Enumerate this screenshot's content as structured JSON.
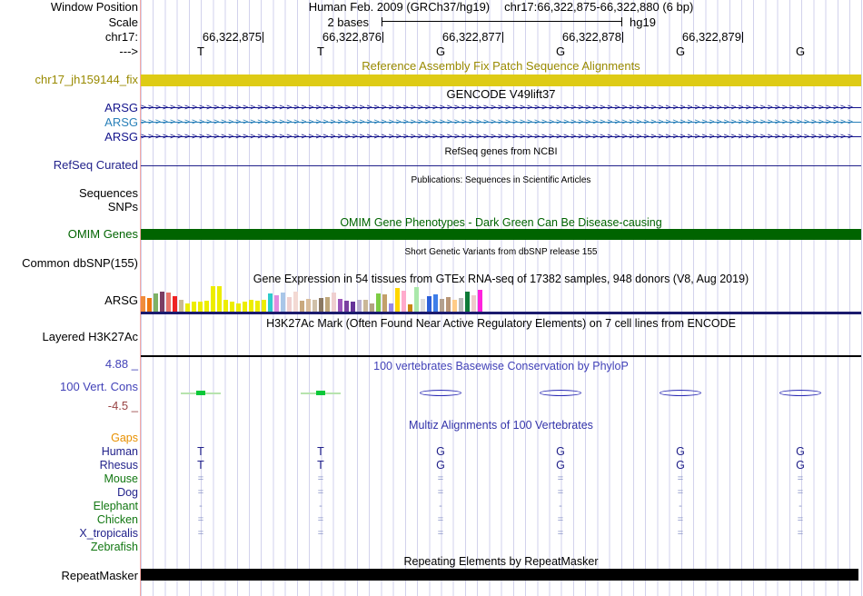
{
  "header": {
    "genome": "Human Feb. 2009 (GRCh37/hg19)",
    "position": "chr17:66,322,875-66,322,880 (6 bp)",
    "scale_value": "2 bases",
    "assembly": "hg19"
  },
  "left_labels": {
    "window_position": "Window Position",
    "scale": "Scale",
    "chrom": "chr17:",
    "direction": "--->",
    "fix_patch": "chr17_jh159144_fix",
    "refseq_curated": "RefSeq Curated",
    "sequences": "Sequences",
    "snps": "SNPs",
    "omim_genes": "OMIM Genes",
    "common_dbsnp": "Common dbSNP(155)",
    "gtex_gene": "ARSG",
    "layered_h3k27ac": "Layered H3K27Ac",
    "cons_upper_limit": "4.88 _",
    "cons_track": "100 Vert. Cons",
    "cons_lower_limit": "-4.5 _",
    "repeatmasker": "RepeatMasker"
  },
  "ruler": {
    "positions": [
      "66,322,875",
      "66,322,876",
      "66,322,877",
      "66,322,878",
      "66,322,879"
    ],
    "bases": [
      "T",
      "T",
      "G",
      "G",
      "G",
      "G"
    ]
  },
  "track_titles": {
    "fix_patch": "Reference Assembly Fix Patch Sequence Alignments",
    "gencode": "GENCODE V49lift37",
    "refseq": "RefSeq genes from NCBI",
    "publications": "Publications: Sequences in Scientific Articles",
    "omim": "OMIM Gene Phenotypes - Dark Green Can Be Disease-causing",
    "dbsnp": "Short Genetic Variants from dbSNP release 155",
    "gtex": "Gene Expression in 54 tissues from GTEx RNA-seq of 17382 samples, 948 donors (V8, Aug 2019)",
    "h3k27ac": "H3K27Ac Mark (Often Found Near Active Regulatory Elements) on 7 cell lines from ENCODE",
    "phylop": "100 vertebrates Basewise Conservation by PhyloP",
    "multiz": "Multiz Alignments of 100 Vertebrates",
    "repeatmasker": "Repeating Elements by RepeatMasker"
  },
  "gencode": {
    "transcripts": [
      {
        "label": "ARSG",
        "color": "#14148C"
      },
      {
        "label": "ARSG",
        "color": "#2980B9"
      },
      {
        "label": "ARSG",
        "color": "#14148C"
      }
    ]
  },
  "colors": {
    "fix_patch_bar": "#DECB15",
    "omim_bar": "#006400",
    "repeat_bar": "#000000",
    "gtex_baseline": "#1B1B6E",
    "refseq_line": "#22228B",
    "olive_text": "#998A00",
    "phylop_text": "#4242B8",
    "multiz_text": "#3333AA",
    "navy": "#22228B",
    "neg_limit_text": "#994444"
  },
  "chart_data": {
    "type": "bar",
    "title": "Gene Expression in 54 tissues from GTEx RNA-seq of 17382 samples, 948 donors (V8, Aug 2019)",
    "gene": "ARSG",
    "note": "values are relative expression bar heights in px (max 30)",
    "bars": [
      {
        "color": "#F08C3C",
        "value": 17
      },
      {
        "color": "#EE7711",
        "value": 15
      },
      {
        "color": "#7EB266",
        "value": 20
      },
      {
        "color": "#7A3D63",
        "value": 22
      },
      {
        "color": "#E8756A",
        "value": 21
      },
      {
        "color": "#EE2222",
        "value": 17
      },
      {
        "color": "#C9BA93",
        "value": 13
      },
      {
        "color": "#EDED00",
        "value": 9
      },
      {
        "color": "#EDED00",
        "value": 11
      },
      {
        "color": "#EDED00",
        "value": 11
      },
      {
        "color": "#EDED00",
        "value": 12
      },
      {
        "color": "#EDED00",
        "value": 28
      },
      {
        "color": "#EDED00",
        "value": 28
      },
      {
        "color": "#EDED00",
        "value": 13
      },
      {
        "color": "#EDED00",
        "value": 11
      },
      {
        "color": "#EDED00",
        "value": 9
      },
      {
        "color": "#EDED00",
        "value": 11
      },
      {
        "color": "#EDED00",
        "value": 13
      },
      {
        "color": "#EDED00",
        "value": 12
      },
      {
        "color": "#EDED00",
        "value": 13
      },
      {
        "color": "#2ECCCC",
        "value": 20
      },
      {
        "color": "#E08CE0",
        "value": 18
      },
      {
        "color": "#A9C6E8",
        "value": 21
      },
      {
        "color": "#EFCFCF",
        "value": 16
      },
      {
        "color": "#F3D9D3",
        "value": 22
      },
      {
        "color": "#C9A97E",
        "value": 12
      },
      {
        "color": "#D9BD9C",
        "value": 14
      },
      {
        "color": "#CFC0A8",
        "value": 13
      },
      {
        "color": "#8A7862",
        "value": 15
      },
      {
        "color": "#BFA77C",
        "value": 16
      },
      {
        "color": "#EFCFCF",
        "value": 21
      },
      {
        "color": "#9C55BB",
        "value": 14
      },
      {
        "color": "#7A3FA0",
        "value": 12
      },
      {
        "color": "#663399",
        "value": 11
      },
      {
        "color": "#B9AFCF",
        "value": 13
      },
      {
        "color": "#C9B797",
        "value": 13
      },
      {
        "color": "#B3A383",
        "value": 9
      },
      {
        "color": "#7ECC44",
        "value": 20
      },
      {
        "color": "#C3A06A",
        "value": 19
      },
      {
        "color": "#9688E8",
        "value": 9
      },
      {
        "color": "#FFD700",
        "value": 26
      },
      {
        "color": "#FFAACC",
        "value": 23
      },
      {
        "color": "#C98711",
        "value": 8
      },
      {
        "color": "#AAE8AA",
        "value": 27
      },
      {
        "color": "#DDDDDD",
        "value": 14
      },
      {
        "color": "#2B5FD9",
        "value": 17
      },
      {
        "color": "#3E7EE8",
        "value": 19
      },
      {
        "color": "#B3A08E",
        "value": 14
      },
      {
        "color": "#B99677",
        "value": 16
      },
      {
        "color": "#FFCC88",
        "value": 13
      },
      {
        "color": "#BBBBBB",
        "value": 15
      },
      {
        "color": "#0E7A38",
        "value": 22
      },
      {
        "color": "#EFCACA",
        "value": 18
      },
      {
        "color": "#FF22DD",
        "value": 24
      }
    ]
  },
  "conservation": {
    "marks": [
      "positive",
      "positive",
      "negative",
      "negative",
      "negative",
      "negative"
    ]
  },
  "multiz": {
    "rows": [
      {
        "label": "Gaps",
        "color": "#E89000",
        "cells": [
          "",
          "",
          "",
          "",
          "",
          ""
        ]
      },
      {
        "label": "Human",
        "color": "#22228B",
        "cells": [
          "T",
          "T",
          "G",
          "G",
          "G",
          "G"
        ]
      },
      {
        "label": "Rhesus",
        "color": "#22228B",
        "cells": [
          "T",
          "T",
          "G",
          "G",
          "G",
          "G"
        ]
      },
      {
        "label": "Mouse",
        "color": "#117711",
        "cells": [
          "=",
          "=",
          "=",
          "=",
          "=",
          "="
        ]
      },
      {
        "label": "Dog",
        "color": "#22228B",
        "cells": [
          "=",
          "=",
          "=",
          "=",
          "=",
          "="
        ]
      },
      {
        "label": "Elephant",
        "color": "#117711",
        "cells": [
          "-",
          "-",
          "-",
          "-",
          "-",
          "-"
        ]
      },
      {
        "label": "Chicken",
        "color": "#117711",
        "cells": [
          "=",
          "=",
          "=",
          "=",
          "=",
          "="
        ]
      },
      {
        "label": "X_tropicalis",
        "color": "#22228B",
        "cells": [
          "=",
          "=",
          "=",
          "=",
          "=",
          "="
        ]
      },
      {
        "label": "Zebrafish",
        "color": "#117711",
        "cells": [
          "",
          "",
          "",
          "",
          "",
          ""
        ]
      }
    ]
  }
}
